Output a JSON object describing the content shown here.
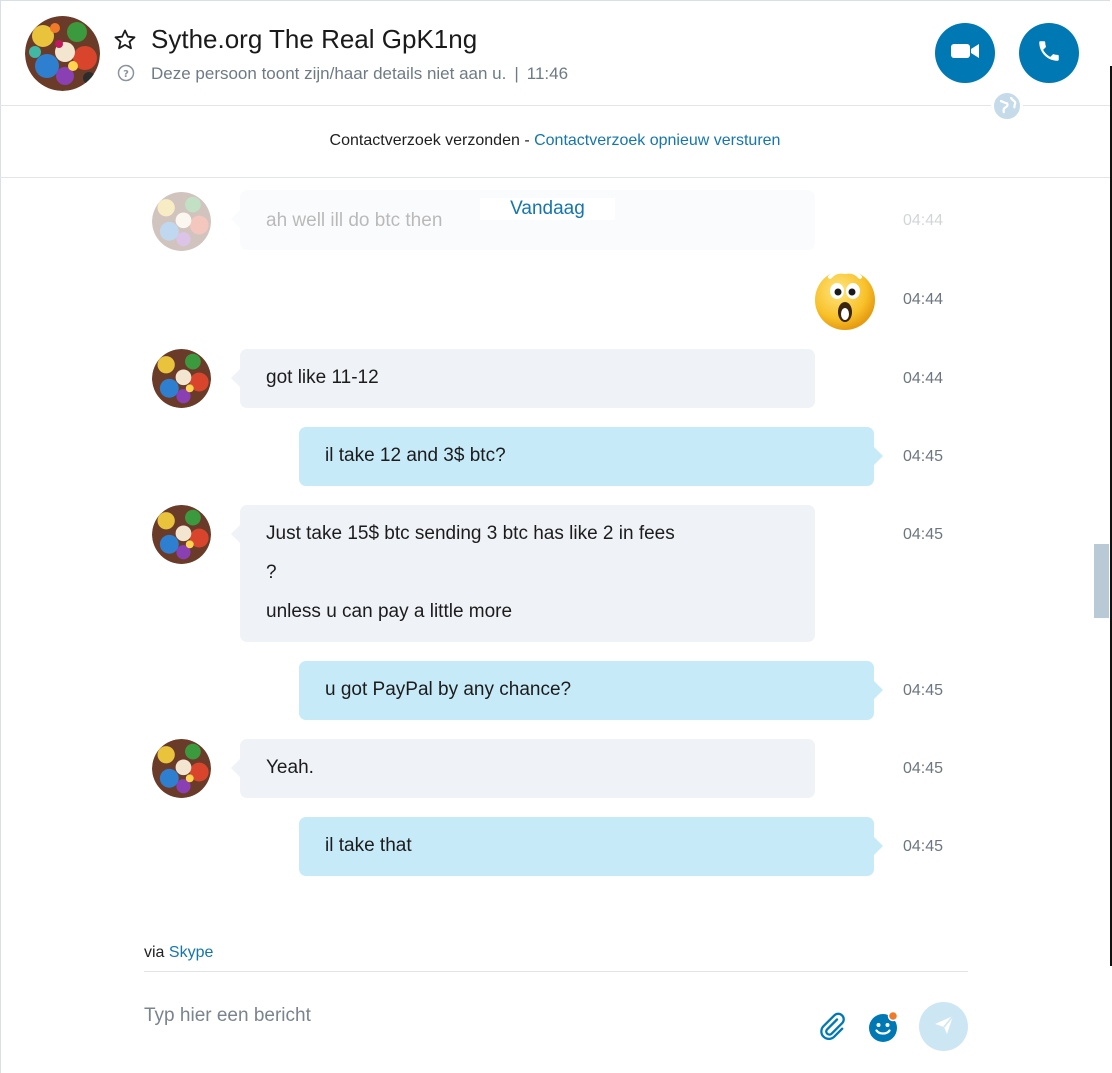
{
  "header": {
    "contact_name": "Sythe.org The Real GpK1ng",
    "presence": "Deze persoon toont zijn/haar details niet aan u.",
    "separator": "|",
    "time": "11:46",
    "accent_color": "#0078b4"
  },
  "request_bar": {
    "status": "Contactverzoek verzonden",
    "separator": " - ",
    "resend_link": "Contactverzoek opnieuw versturen"
  },
  "conversation": {
    "date_divider": "Vandaag",
    "messages": [
      {
        "direction": "incoming",
        "lines": [
          "ah well ill do btc then"
        ],
        "time": "04:44",
        "faded": true
      },
      {
        "direction": "outgoing",
        "emoticon": "surprised-emoticon",
        "time": "04:44"
      },
      {
        "direction": "incoming",
        "lines": [
          "got like 11-12"
        ],
        "time": "04:44"
      },
      {
        "direction": "outgoing",
        "lines": [
          "il take 12 and 3$ btc?"
        ],
        "time": "04:45"
      },
      {
        "direction": "incoming",
        "lines": [
          "Just take 15$ btc sending 3 btc has like 2 in fees",
          "?",
          "unless u can pay a little more"
        ],
        "time": "04:45"
      },
      {
        "direction": "outgoing",
        "lines": [
          "u got PayPal by any chance?"
        ],
        "time": "04:45"
      },
      {
        "direction": "incoming",
        "lines": [
          "Yeah."
        ],
        "time": "04:45"
      },
      {
        "direction": "outgoing",
        "lines": [
          "il take that"
        ],
        "time": "04:45"
      }
    ]
  },
  "composer": {
    "via_prefix": "via",
    "via_link": "Skype",
    "placeholder": "Typ hier een bericht"
  },
  "icons": {
    "favorite": "star-outline-icon",
    "help": "question-circle-icon",
    "video_call": "video-camera-icon",
    "audio_call": "phone-icon",
    "network": "globe-icon",
    "attach": "paperclip-icon",
    "emoji": "smiley-icon",
    "send": "send-arrow-icon"
  },
  "colors": {
    "incoming_bubble": "#eff2f6",
    "outgoing_bubble": "#c7eaf9",
    "link": "#1576ad",
    "send_button_disabled": "#cde6f3"
  }
}
